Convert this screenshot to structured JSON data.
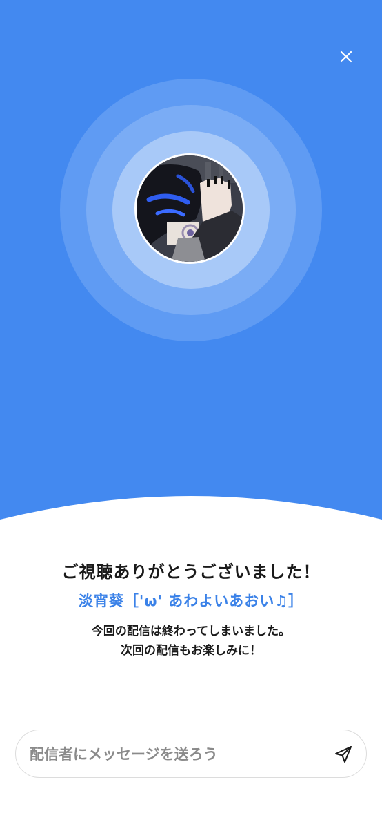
{
  "header": {
    "close_icon": "close-icon"
  },
  "streamer": {
    "avatar_icon": "avatar-image",
    "name": "淡宵葵［'ω' あわよいあおい♫］"
  },
  "end_screen": {
    "thanks": "ご視聴ありがとうございました！",
    "ended_line1": "今回の配信は終わってしまいました。",
    "ended_line2": "次回の配信もお楽しみに！"
  },
  "message": {
    "placeholder": "配信者にメッセージを送ろう",
    "value": "",
    "send_icon": "send-icon"
  },
  "colors": {
    "hero_background": "#4389f0",
    "ring_outer": "#5f9bf3",
    "ring_middle": "#7aacf5",
    "ring_inner": "#a8c9f8",
    "accent_text": "#3b82e8"
  }
}
